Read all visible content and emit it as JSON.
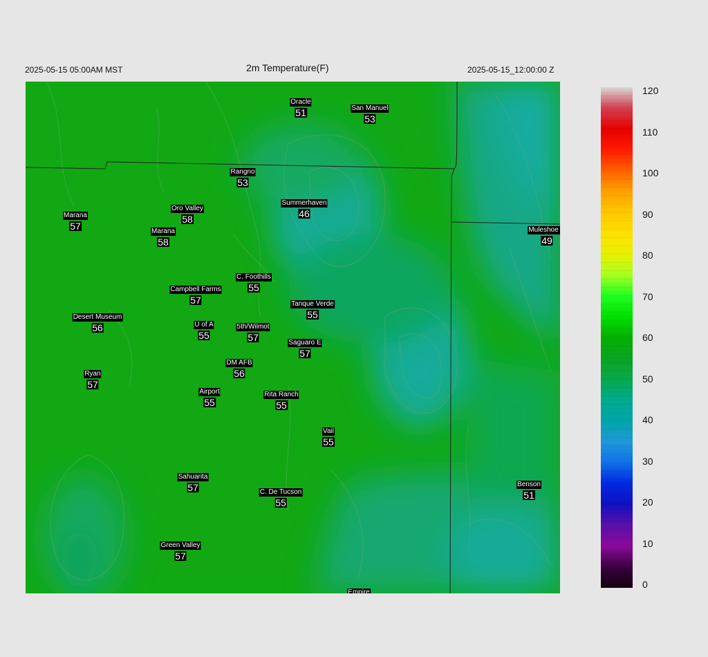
{
  "header": {
    "local_time": "2025-05-15 05:00AM MST",
    "title": "2m Temperature(F)",
    "utc_time": "2025-05-15_12:00:00 Z"
  },
  "stations": [
    {
      "name": "Oracle",
      "value": "51"
    },
    {
      "name": "San Manuel",
      "value": "53"
    },
    {
      "name": "Rangno",
      "value": "53"
    },
    {
      "name": "Summerhaven",
      "value": "46"
    },
    {
      "name": "Marana",
      "value": "57"
    },
    {
      "name": "Oro Valley",
      "value": "58"
    },
    {
      "name": "Marana",
      "value": "58"
    },
    {
      "name": "Muleshoe R",
      "value": "49"
    },
    {
      "name": "C. Foothills",
      "value": "55"
    },
    {
      "name": "Campbell Farms",
      "value": "57"
    },
    {
      "name": "Tanque Verde",
      "value": "55"
    },
    {
      "name": "Desert Museum",
      "value": "56"
    },
    {
      "name": "U of A",
      "value": "55"
    },
    {
      "name": "5th/Wilmot",
      "value": "57"
    },
    {
      "name": "Saguaro E",
      "value": "57"
    },
    {
      "name": "DM AFB",
      "value": "56"
    },
    {
      "name": "Ryan",
      "value": "57"
    },
    {
      "name": "Airport",
      "value": "55"
    },
    {
      "name": "Rita Ranch",
      "value": "55"
    },
    {
      "name": "Vail",
      "value": "55"
    },
    {
      "name": "Sahuarita",
      "value": "57"
    },
    {
      "name": "C. De Tucson",
      "value": "55"
    },
    {
      "name": "Benson",
      "value": "51"
    },
    {
      "name": "Green Valley",
      "value": "57"
    },
    {
      "name": "Empire",
      "value": ""
    }
  ],
  "colorbar": {
    "ticks": [
      "0",
      "10",
      "20",
      "30",
      "40",
      "50",
      "60",
      "70",
      "80",
      "90",
      "100",
      "110",
      "120"
    ],
    "range": [
      0,
      120
    ],
    "stops": [
      {
        "value": 0,
        "color": "#140010"
      },
      {
        "value": 5,
        "color": "#3a0040"
      },
      {
        "value": 10,
        "color": "#8a0a9a"
      },
      {
        "value": 15,
        "color": "#5a10a8"
      },
      {
        "value": 20,
        "color": "#1010c0"
      },
      {
        "value": 25,
        "color": "#0028e0"
      },
      {
        "value": 30,
        "color": "#1070e8"
      },
      {
        "value": 35,
        "color": "#2098d8"
      },
      {
        "value": 40,
        "color": "#00a6a8"
      },
      {
        "value": 45,
        "color": "#00aa90"
      },
      {
        "value": 50,
        "color": "#08a84a"
      },
      {
        "value": 55,
        "color": "#0aa422"
      },
      {
        "value": 60,
        "color": "#04b000"
      },
      {
        "value": 65,
        "color": "#00e000"
      },
      {
        "value": 70,
        "color": "#20ff20"
      },
      {
        "value": 75,
        "color": "#a8ff20"
      },
      {
        "value": 80,
        "color": "#e8f000"
      },
      {
        "value": 85,
        "color": "#ffe000"
      },
      {
        "value": 90,
        "color": "#ffc800"
      },
      {
        "value": 95,
        "color": "#ffa000"
      },
      {
        "value": 100,
        "color": "#ff6000"
      },
      {
        "value": 105,
        "color": "#ff1a00"
      },
      {
        "value": 110,
        "color": "#e60000"
      },
      {
        "value": 115,
        "color": "#d24050"
      },
      {
        "value": 120,
        "color": "#d8d8d8"
      }
    ]
  },
  "colors": {
    "warm_green": "#11a814",
    "cool_teal": "#17ab9a",
    "mid_green": "#0fa65a",
    "border_line": "#222222"
  }
}
